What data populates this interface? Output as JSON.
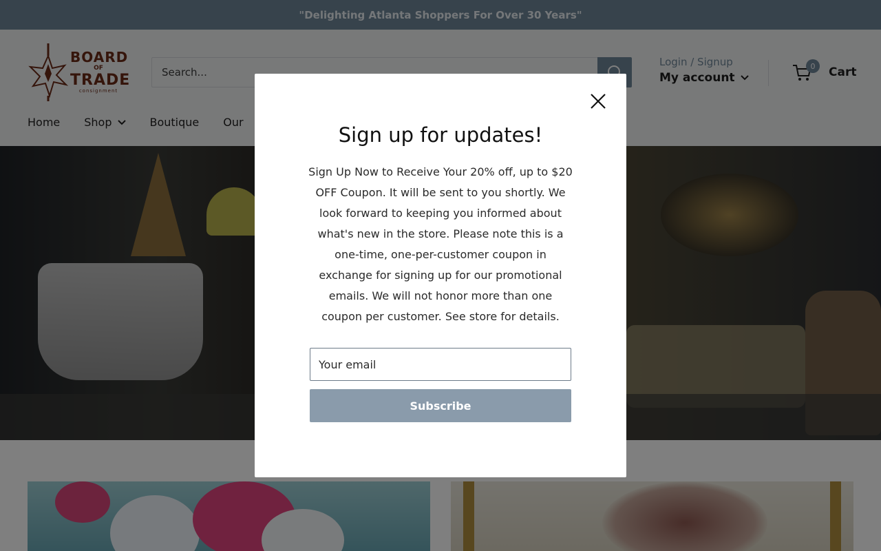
{
  "announcement": {
    "text": "\"Delighting Atlanta Shoppers For Over 30 Years\""
  },
  "logo": {
    "line1": "BOARD",
    "line2": "OF",
    "line3": "TRADE",
    "line4": "consignment"
  },
  "search": {
    "placeholder": "Search...",
    "icon": "search-icon"
  },
  "account": {
    "login_label": "Login / Signup",
    "my_account_label": "My account",
    "icon": "chevron-down-icon"
  },
  "cart": {
    "count": "0",
    "label": "Cart",
    "icon": "cart-icon"
  },
  "nav": {
    "items": [
      {
        "label": "Home"
      },
      {
        "label": "Shop"
      },
      {
        "label": "Boutique"
      },
      {
        "label": "Our"
      }
    ]
  },
  "modal": {
    "title": "Sign up for updates!",
    "body": "Sign Up Now to Receive Your 20% off, up to $20 OFF Coupon. It will be sent to you shortly. We look forward to keeping you informed about what's new in the store. Please note this is a one-time, one-per-customer coupon in exchange for signing up for our promotional emails. We will not honor more than one coupon per customer. See store for details.",
    "email_placeholder": "Your email",
    "subscribe_label": "Subscribe",
    "close_icon": "close-icon"
  },
  "colors": {
    "brand": "#6f8699",
    "button": "#8a9bab",
    "logo": "#6b2a17"
  }
}
